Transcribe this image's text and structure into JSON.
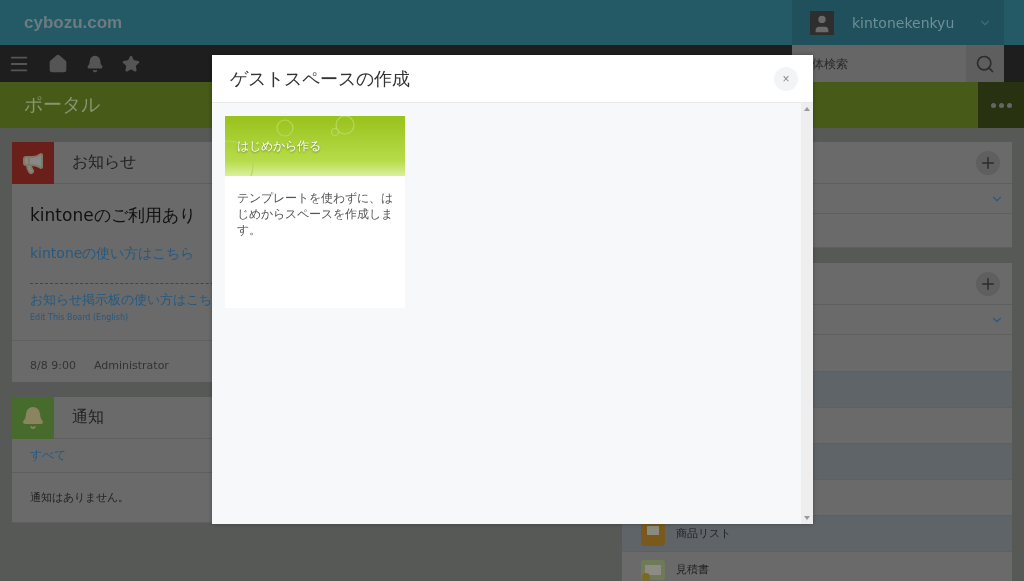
{
  "header": {
    "logo": "cybozu.com",
    "user": "kintonekenkyu"
  },
  "nav": {
    "search_placeholder": "体検索"
  },
  "portal": {
    "title": "ポータル"
  },
  "announcements": {
    "title": "お知らせ",
    "heading": "kintoneのご利用あり",
    "links": [
      "kintoneの使い方はこちら",
      "お知らせ掲示板の使い方はこち"
    ],
    "note": "Edit This Board (English)",
    "date": "8/8 9:00",
    "author": "Administrator"
  },
  "notifications": {
    "title": "通知",
    "filter": "すべて",
    "message": "通知はありません。"
  },
  "apps": [
    {
      "name": "商品リスト"
    },
    {
      "name": "見積書"
    }
  ],
  "dialog": {
    "title": "ゲストスペースの作成",
    "close": "×",
    "templates": [
      {
        "title": "はじめから作る",
        "description": "テンプレートを使わずに、はじめからスペースを作成します。"
      }
    ]
  }
}
